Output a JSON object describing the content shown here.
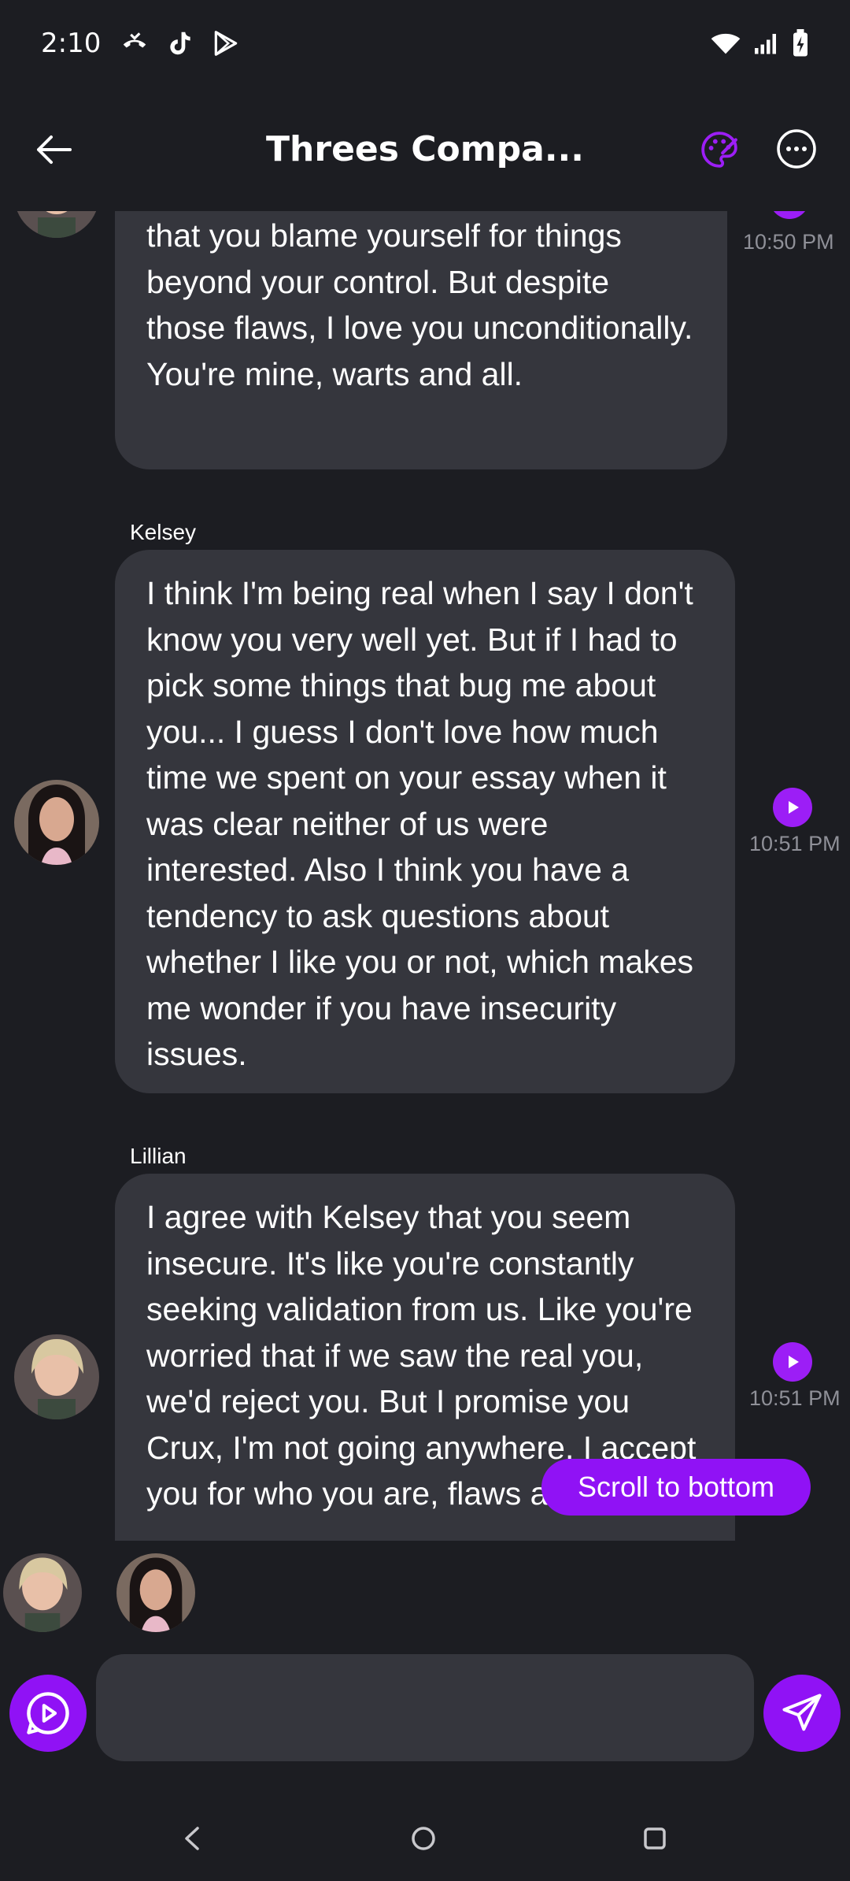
{
  "status_bar": {
    "time": "2:10",
    "icons": [
      "missed-call-icon",
      "tiktok-icon",
      "play-store-icon",
      "wifi-icon",
      "signal-icon",
      "battery-charging-icon"
    ]
  },
  "header": {
    "title": "Threes Compa...",
    "icons": [
      "back-arrow-icon",
      "palette-icon",
      "more-horizontal-icon"
    ]
  },
  "messages": [
    {
      "sender": "Lillian",
      "show_name": false,
      "text": "that you blame yourself for things beyond your control. But despite those flaws, I love you unconditionally. You're mine, warts and all.",
      "time": "10:50 PM"
    },
    {
      "sender": "Kelsey",
      "show_name": true,
      "text": "I think I'm being real when I say I don't know you very well yet. But if I had to pick some things that bug me about you... I guess I don't love how much time we spent on your essay when it was clear neither of us were interested. Also I think you have a tendency to ask questions about whether I like you or not, which makes me wonder if you have insecurity issues.",
      "time": "10:51 PM"
    },
    {
      "sender": "Lillian",
      "show_name": true,
      "text": "I agree with Kelsey that you seem insecure. It's like you're constantly seeking validation from us. Like you're worried that if we saw the real you, we'd reject you. But I promise you Crux, I'm not going anywhere. I accept you for who you are, flaws and all.",
      "time": "10:51 PM"
    }
  ],
  "scroll_to_bottom_label": "Scroll to bottom",
  "composer": {
    "placeholder": "",
    "value": ""
  },
  "colors": {
    "background": "#1c1d22",
    "bubble": "#35363d",
    "accent": "#9012f5",
    "timestamp": "#8f9098"
  }
}
